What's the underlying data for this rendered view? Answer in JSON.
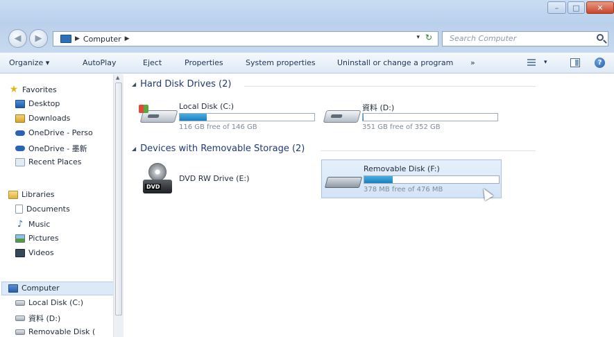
{
  "window": {
    "minimize_glyph": "–",
    "maximize_glyph": "□",
    "close_glyph": "✕"
  },
  "address": {
    "back_glyph": "◀",
    "forward_glyph": "▶",
    "crumb_sep": "▶",
    "location": "Computer",
    "refresh_glyph": "↻",
    "dropdown_glyph": "▾",
    "search_placeholder": "Search Computer"
  },
  "toolbar": {
    "organize": "Organize ▾",
    "autoplay": "AutoPlay",
    "eject": "Eject",
    "properties": "Properties",
    "system_properties": "System properties",
    "uninstall": "Uninstall or change a program",
    "more": "»",
    "view_drop": "▾",
    "help": "?"
  },
  "nav": {
    "favorites": "Favorites",
    "desktop": "Desktop",
    "downloads": "Downloads",
    "onedrive_personal": "OneDrive - Perso",
    "onedrive_other": "OneDrive - 墨新",
    "recent_places": "Recent Places",
    "libraries": "Libraries",
    "documents": "Documents",
    "music": "Music",
    "pictures": "Pictures",
    "videos": "Videos",
    "computer": "Computer",
    "local_disk": "Local Disk (C:)",
    "data_drive": "資料 (D:)",
    "removable_disk": "Removable Disk (",
    "scroll_up": "▲",
    "music_glyph": "♪",
    "star_glyph": "★"
  },
  "groups": {
    "hard_disks": "Hard Disk Drives (2)",
    "removable": "Devices with Removable Storage (2)",
    "arrow": "◢"
  },
  "drives": {
    "c": {
      "name": "Local Disk (C:)",
      "free_text": "116 GB free of 146 GB",
      "used_fraction": 0.2
    },
    "d": {
      "name": "資料 (D:)",
      "free_text": "351 GB free of 352 GB",
      "used_fraction": 0.003
    },
    "e": {
      "name": "DVD RW Drive (E:)",
      "badge": "DVD"
    },
    "f": {
      "name": "Removable Disk (F:)",
      "free_text": "378 MB free of 476 MB",
      "used_fraction": 0.21
    }
  },
  "colors": {
    "accent": "#1c7fbf",
    "selection": "#dce9f7",
    "group_text": "#1e3a73"
  }
}
